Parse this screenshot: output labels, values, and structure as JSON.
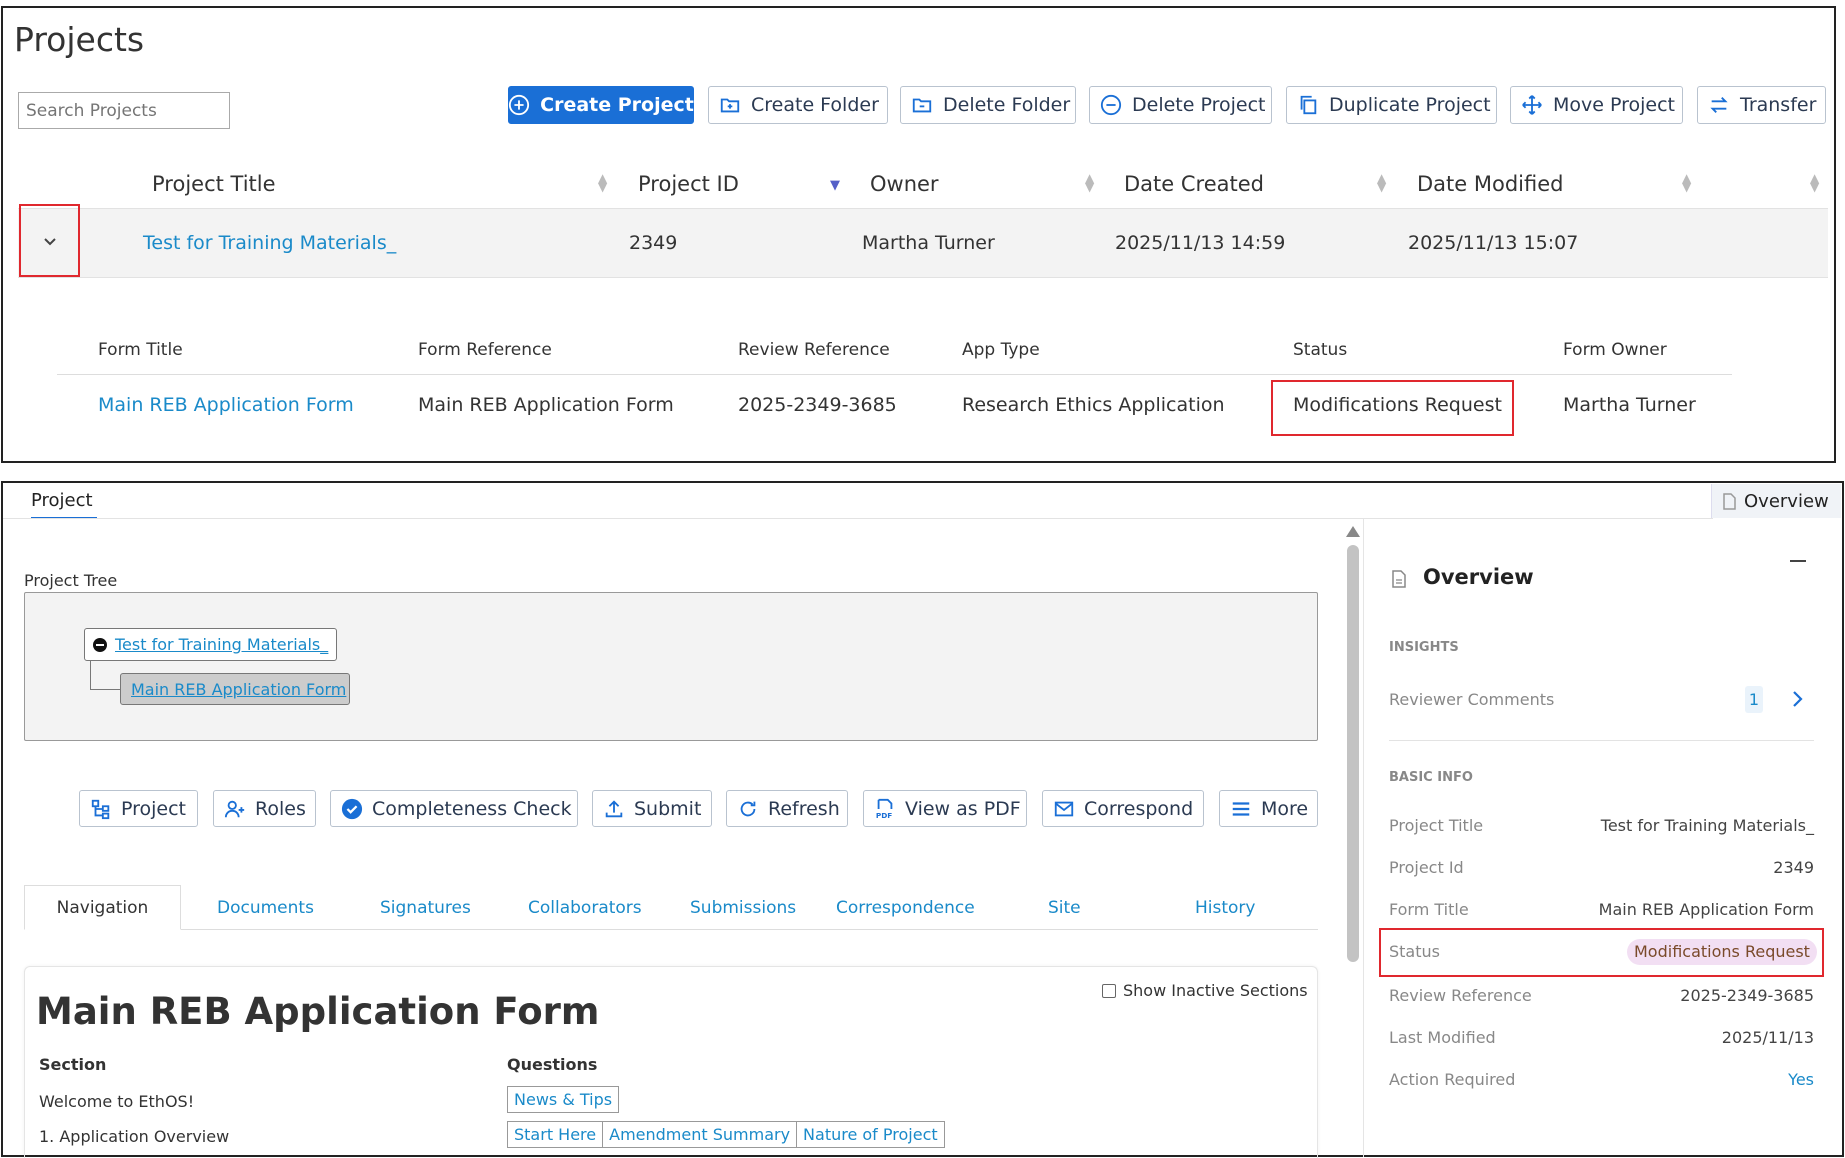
{
  "projects": {
    "title": "Projects",
    "search_placeholder": "Search Projects",
    "toolbar": {
      "create_project": "Create Project",
      "create_folder": "Create Folder",
      "delete_folder": "Delete Folder",
      "delete_project": "Delete Project",
      "duplicate_project": "Duplicate Project",
      "move_project": "Move Project",
      "transfer": "Transfer"
    },
    "columns": [
      "Project Title",
      "Project ID",
      "Owner",
      "Date Created",
      "Date Modified"
    ],
    "row": {
      "title": "Test for Training Materials_",
      "id": "2349",
      "owner": "Martha Turner",
      "date_created": "2025/11/13 14:59",
      "date_modified": "2025/11/13 15:07"
    },
    "form_columns": [
      "Form Title",
      "Form Reference",
      "Review Reference",
      "App Type",
      "Status",
      "Form Owner"
    ],
    "form_row": {
      "title": "Main REB Application Form",
      "reference": "Main REB Application Form",
      "review_reference": "2025-2349-3685",
      "app_type": "Research Ethics Application",
      "status": "Modifications Request",
      "owner": "Martha Turner"
    }
  },
  "project_view": {
    "tab_label": "Project",
    "overview_tab": "Overview",
    "tree_label": "Project Tree",
    "tree_root": "Test for Training Materials_",
    "tree_child": "Main REB Application Form",
    "actions": {
      "project": "Project",
      "roles": "Roles",
      "completeness": "Completeness Check",
      "submit": "Submit",
      "refresh": "Refresh",
      "pdf": "View as PDF",
      "correspond": "Correspond",
      "more": "More"
    },
    "tabs": [
      "Navigation",
      "Documents",
      "Signatures",
      "Collaborators",
      "Submissions",
      "Correspondence",
      "Site",
      "History"
    ],
    "form_heading": "Main REB Application Form",
    "show_inactive": "Show Inactive Sections",
    "section_header": "Section",
    "questions_header": "Questions",
    "sections": [
      {
        "name": "Welcome to EthOS!",
        "questions": [
          "News & Tips"
        ]
      },
      {
        "name": "1. Application Overview",
        "questions": [
          "Start Here",
          "Amendment Summary",
          "Nature of Project"
        ]
      }
    ]
  },
  "overview": {
    "title": "Overview",
    "insights_label": "INSIGHTS",
    "reviewer_comments": "Reviewer Comments",
    "reviewer_count": "1",
    "basic_info_label": "BASIC INFO",
    "fields": [
      {
        "label": "Project Title",
        "value": "Test for Training Materials_"
      },
      {
        "label": "Project Id",
        "value": "2349"
      },
      {
        "label": "Form Title",
        "value": "Main REB Application Form"
      },
      {
        "label": "Status",
        "value": "Modifications Request"
      },
      {
        "label": "Review Reference",
        "value": "2025-2349-3685"
      },
      {
        "label": "Last Modified",
        "value": "2025/11/13"
      },
      {
        "label": "Action Required",
        "value": "Yes"
      }
    ]
  }
}
